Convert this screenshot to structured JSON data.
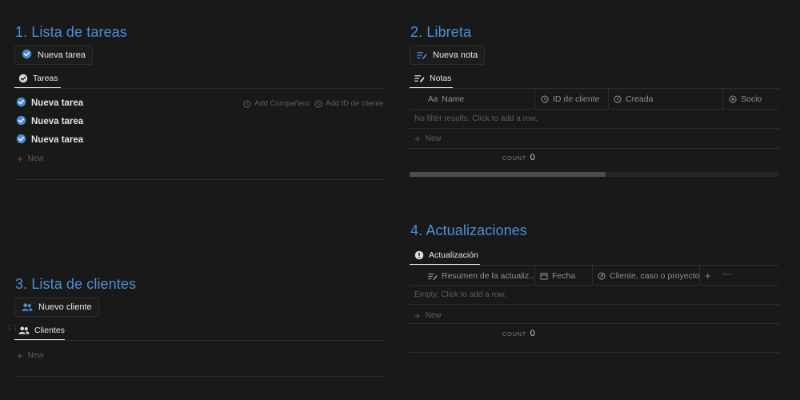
{
  "section1": {
    "title": "1. Lista de tareas",
    "button_label": "Nueva tarea",
    "tab_label": "Tareas",
    "tasks": [
      "Nueva tarea",
      "Nueva tarea",
      "Nueva tarea"
    ],
    "hint_companero": "Add Compañero",
    "hint_cliente": "Add ID de cliente",
    "new_label": "New"
  },
  "section2": {
    "title": "2. Libreta",
    "button_label": "Nueva nota",
    "tab_label": "Notas",
    "columns": [
      "Name",
      "ID de cliente",
      "Creada",
      "Socio"
    ],
    "empty_text": "No filter results. Click to add a row.",
    "new_label": "New",
    "count_label": "COUNT",
    "count_value": "0",
    "scroll_fraction": 0.53
  },
  "section3": {
    "title": "3. Lista de clientes",
    "button_label": "Nuevo cliente",
    "tab_label": "Clientes",
    "new_label": "New"
  },
  "section4": {
    "title": "4. Actualizaciones",
    "tab_label": "Actualización",
    "columns": [
      "Resumen de la actualiz...",
      "Fecha",
      "Cliente, caso o proyecto"
    ],
    "add_column": "+",
    "more": "···",
    "empty_text": "Empty. Click to add a row.",
    "new_label": "New",
    "count_label": "COUNT",
    "count_value": "0"
  },
  "colors": {
    "background": "#191919",
    "accent_blue": "#4b8ed6",
    "text": "#e6e6e6",
    "muted": "#5d5d5d"
  },
  "icons": {
    "check": "check-circle-icon",
    "people": "people-icon",
    "note": "note-lines-icon",
    "alert": "alert-circle-icon",
    "plus": "plus-icon"
  }
}
